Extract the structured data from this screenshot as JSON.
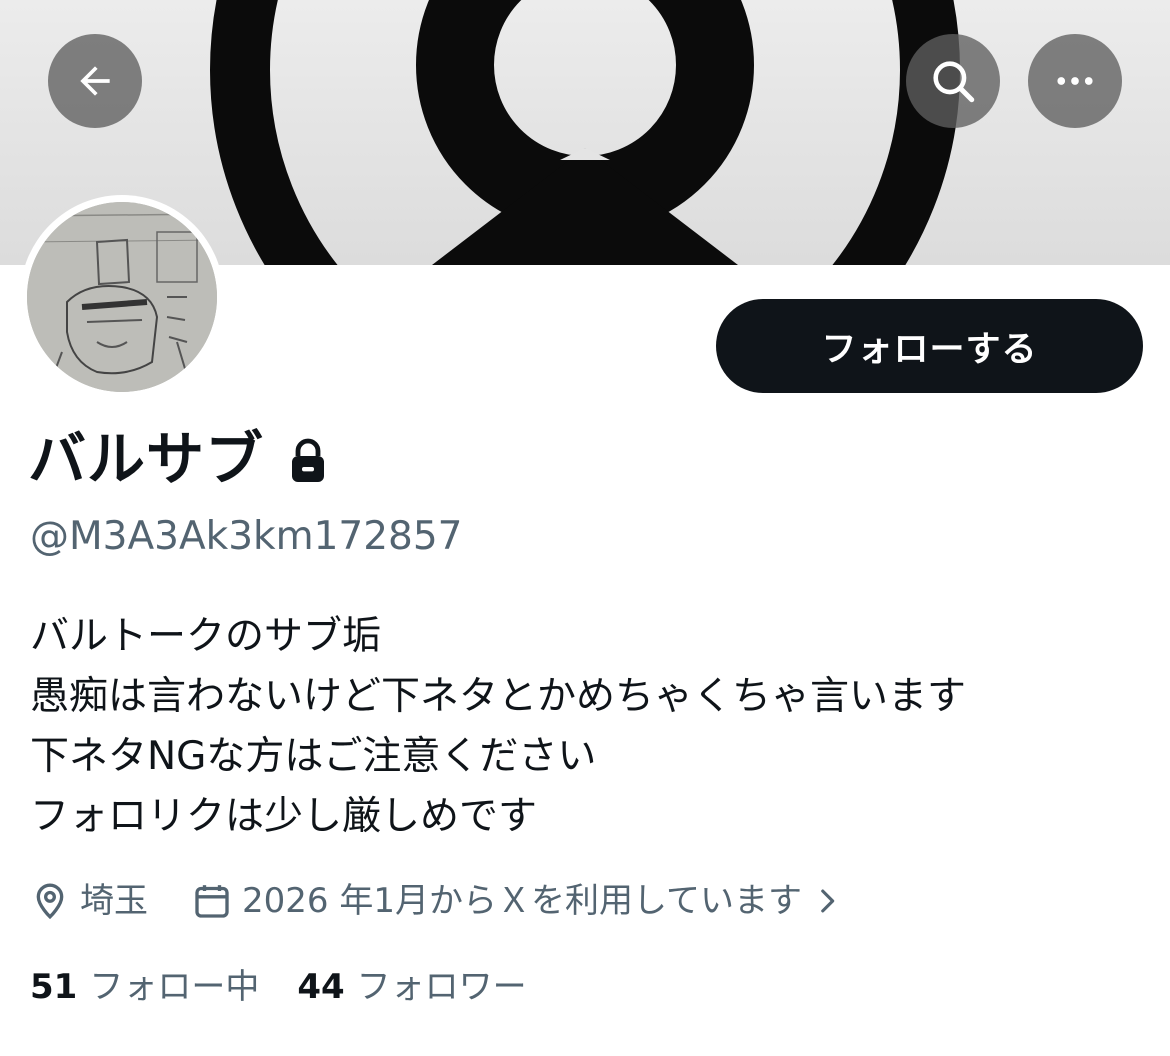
{
  "profile": {
    "display_name": "バルサブ",
    "handle": "@M3A3Ak3km172857",
    "follow_label": "フォローする",
    "bio": [
      "バルトークのサブ垢",
      "愚痴は言わないけど下ネタとかめちゃくちゃ言います",
      "下ネタNGな方はご注意ください",
      "フォロリクは少し厳しめです"
    ],
    "location": "埼玉",
    "joined": "2026 年1月からＸを利用しています",
    "following_count": "51",
    "following_label": "フォロー中",
    "followers_count": "44",
    "followers_label": "フォロワー"
  },
  "icons": {
    "back": "arrow-left-icon",
    "search": "search-icon",
    "more": "more-dots-icon",
    "lock": "lock-icon",
    "location": "location-pin-icon",
    "calendar": "calendar-icon",
    "chevron": "chevron-right-icon"
  },
  "colors": {
    "primary_text": "#0f1419",
    "secondary_text": "#536471",
    "follow_button_bg": "#0f1419",
    "overlay_button_bg": "#5f5f5f"
  }
}
